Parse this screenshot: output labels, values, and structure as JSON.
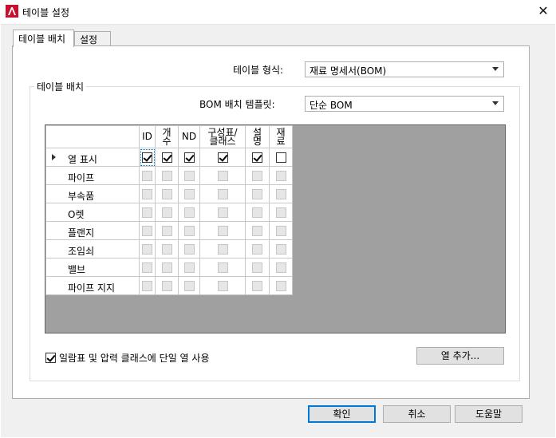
{
  "window": {
    "title": "테이블 설정",
    "close_glyph": "✕"
  },
  "tabs": [
    {
      "label": "테이블 배치"
    },
    {
      "label": "설정"
    }
  ],
  "table_style": {
    "label": "테이블 형식:",
    "value": "재료 명세서(BOM)"
  },
  "group": {
    "title": "테이블 배치",
    "template_label": "BOM 배치 템플릿:",
    "template_value": "단순 BOM"
  },
  "grid": {
    "columns": [
      {
        "line1": "ID",
        "line2": ""
      },
      {
        "line1": "개",
        "line2": "수"
      },
      {
        "line1": "ND",
        "line2": ""
      },
      {
        "line1": "구성표/",
        "line2": "클래스"
      },
      {
        "line1": "설",
        "line2": "명"
      },
      {
        "line1": "재",
        "line2": "료"
      }
    ],
    "rows": [
      {
        "name": "열 표시",
        "checks": [
          true,
          true,
          true,
          true,
          true,
          false
        ],
        "enabled": true
      },
      {
        "name": "파이프",
        "checks": [
          false,
          false,
          false,
          false,
          false,
          false
        ],
        "enabled": false
      },
      {
        "name": "부속품",
        "checks": [
          false,
          false,
          false,
          false,
          false,
          false
        ],
        "enabled": false
      },
      {
        "name": "O렛",
        "checks": [
          false,
          false,
          false,
          false,
          false,
          false
        ],
        "enabled": false
      },
      {
        "name": "플랜지",
        "checks": [
          false,
          false,
          false,
          false,
          false,
          false
        ],
        "enabled": false
      },
      {
        "name": "조임쇠",
        "checks": [
          false,
          false,
          false,
          false,
          false,
          false
        ],
        "enabled": false
      },
      {
        "name": "밸브",
        "checks": [
          false,
          false,
          false,
          false,
          false,
          false
        ],
        "enabled": false
      },
      {
        "name": "파이프 지지",
        "checks": [
          false,
          false,
          false,
          false,
          false,
          false
        ],
        "enabled": false
      }
    ]
  },
  "single_column": {
    "label": "일람표 및 압력 클래스에 단일 열 사용",
    "checked": true
  },
  "buttons": {
    "add_column": "열 추가...",
    "ok": "확인",
    "cancel": "취소",
    "help": "도움말"
  }
}
